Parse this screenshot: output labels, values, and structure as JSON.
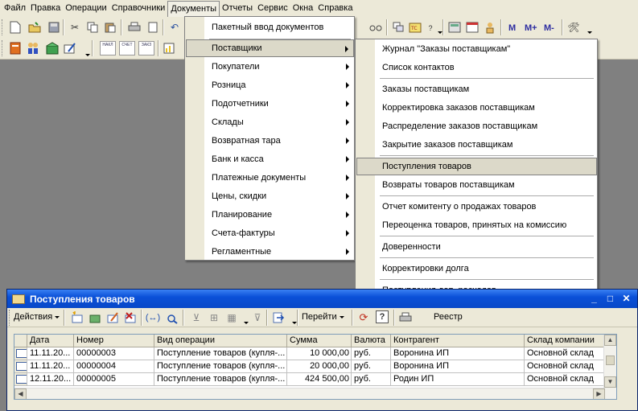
{
  "menubar": {
    "items": [
      "Файл",
      "Правка",
      "Операции",
      "Справочники",
      "Документы",
      "Отчеты",
      "Сервис",
      "Окна",
      "Справка"
    ]
  },
  "toolbar2": {
    "doc_buttons": [
      "НАКЛ",
      "СЧЕТ",
      "ЗАКЗ"
    ]
  },
  "toolbar1": {
    "m_labels": [
      "M",
      "M+",
      "M-"
    ]
  },
  "documents_menu": {
    "items": [
      {
        "label": "Пакетный ввод документов",
        "submenu": false
      },
      {
        "label": "Поставщики",
        "submenu": true,
        "highlighted": true
      },
      {
        "label": "Покупатели",
        "submenu": true
      },
      {
        "label": "Розница",
        "submenu": true
      },
      {
        "label": "Подотчетники",
        "submenu": true
      },
      {
        "label": "Склады",
        "submenu": true
      },
      {
        "label": "Возвратная тара",
        "submenu": true
      },
      {
        "label": "Банк и касса",
        "submenu": true
      },
      {
        "label": "Платежные документы",
        "submenu": true
      },
      {
        "label": "Цены, скидки",
        "submenu": true
      },
      {
        "label": "Планирование",
        "submenu": true
      },
      {
        "label": "Счета-фактуры",
        "submenu": true
      },
      {
        "label": "Регламентные",
        "submenu": true
      }
    ]
  },
  "suppliers_submenu": {
    "items": [
      {
        "label": "Журнал \"Заказы поставщикам\""
      },
      {
        "label": "Список контактов"
      },
      {
        "label": "Заказы поставщикам"
      },
      {
        "label": "Корректировка заказов поставщикам"
      },
      {
        "label": "Распределение заказов поставщикам"
      },
      {
        "label": "Закрытие заказов поставщикам"
      },
      {
        "label": "Поступления товаров",
        "highlighted": true
      },
      {
        "label": "Возвраты товаров поставщикам"
      },
      {
        "label": "Отчет комитенту о продажах товаров"
      },
      {
        "label": "Переоценка товаров, принятых на комиссию"
      },
      {
        "label": "Доверенности"
      },
      {
        "label": "Корректировки долга"
      },
      {
        "label": "Поступления доп. расходов"
      }
    ]
  },
  "window": {
    "title": "Поступления товаров",
    "toolbar": {
      "actions_label": "Действия",
      "goto_label": "Перейти",
      "registry_label": "Реестр"
    },
    "grid": {
      "columns": [
        "Дата",
        "Номер",
        "Вид операции",
        "Сумма",
        "Валюта",
        "Контрагент",
        "Склад компании"
      ],
      "rows": [
        [
          "11.11.20...",
          "00000003",
          "Поступление товаров (купля-...",
          "10 000,00",
          "руб.",
          "Воронина ИП",
          "Основной склад"
        ],
        [
          "11.11.20...",
          "00000004",
          "Поступление товаров (купля-...",
          "20 000,00",
          "руб.",
          "Воронина ИП",
          "Основной склад"
        ],
        [
          "12.11.20...",
          "00000005",
          "Поступление товаров (купля-...",
          "424 500,00",
          "руб.",
          "Родин ИП",
          "Основной склад"
        ]
      ]
    }
  },
  "colors": {
    "chrome": "#ece9d8",
    "desktop": "#808080",
    "titlebar": "#0a50d8",
    "highlight": "#dcd9c9"
  }
}
